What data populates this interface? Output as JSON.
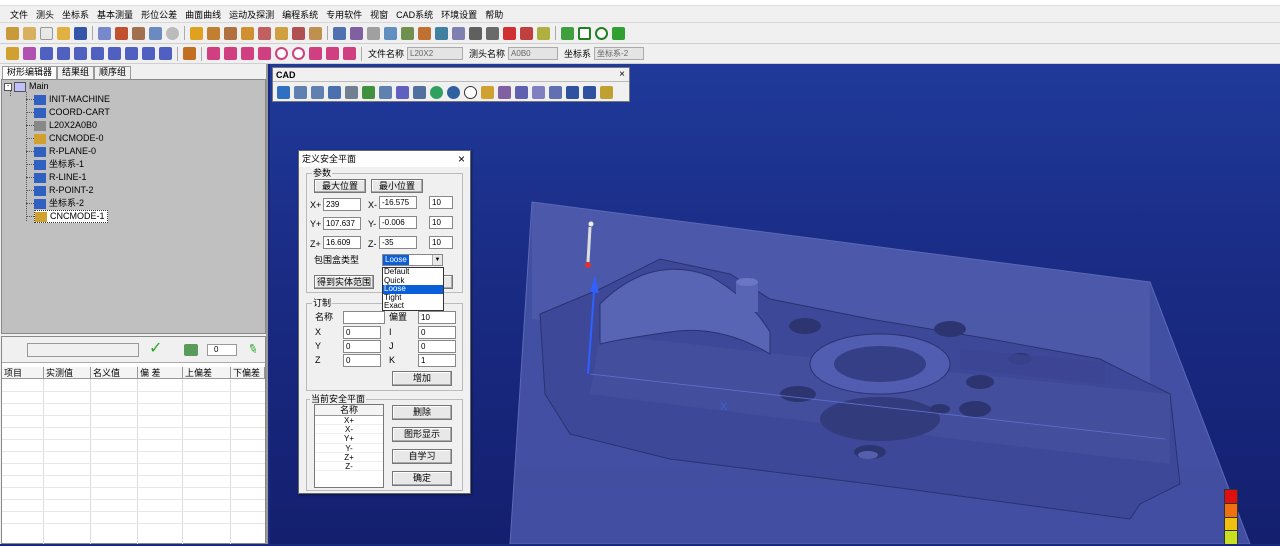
{
  "menu": [
    "文件",
    "测头",
    "坐标系",
    "基本测量",
    "形位公差",
    "曲面曲线",
    "运动及探测",
    "编程系统",
    "专用软件",
    "视窗",
    "CAD系统",
    "环境设置",
    "帮助"
  ],
  "toolbar2": {
    "file_label": "文件名称",
    "file_value": "L20X2",
    "probe_label": "测头名称",
    "probe_value": "A0B0",
    "coord_label": "坐标系",
    "coord_value": "坐标系-2"
  },
  "left_tabs": [
    "树形编辑器",
    "结果组",
    "顺序组"
  ],
  "tree": {
    "root": "Main",
    "items": [
      "INIT-MACHINE",
      "COORD-CART",
      "L20X2A0B0",
      "CNCMODE-0",
      "R-PLANE-0",
      "坐标系-1",
      "R-LINE-1",
      "R-POINT-2",
      "坐标系-2",
      "CNCMODE-1"
    ]
  },
  "bottom_pane": {
    "value_field": "0",
    "columns": [
      "项目",
      "实测值",
      "名义值",
      "偏 差",
      "上偏差",
      "下偏差"
    ]
  },
  "cad": {
    "title": "CAD",
    "close": "×"
  },
  "dialog": {
    "title": "定义安全平面",
    "close": "×",
    "params_group": "参数",
    "max_pos_btn": "最大位置",
    "min_pos_btn": "最小位置",
    "xplus_label": "X+",
    "xplus_value": "239",
    "xminus_label": "X-",
    "xminus_value": "-16.575",
    "x_margin": "10",
    "yplus_label": "Y+",
    "yplus_value": "107.637",
    "yminus_label": "Y-",
    "yminus_value": "-0.006",
    "y_margin": "10",
    "zplus_label": "Z+",
    "zplus_value": "16.609",
    "zminus_label": "Z-",
    "zminus_value": "-35",
    "z_margin": "10",
    "box_type_label": "包围盒类型",
    "box_type_value": "Loose",
    "box_type_options": [
      "Default",
      "Quick",
      "Loose",
      "Tight",
      "Exact"
    ],
    "get_range_btn": "得到实体范围",
    "custom_group": "订制",
    "name_label": "名称",
    "name_value": "",
    "offset_label": "偏置",
    "offset_value": "10",
    "x_label": "X",
    "x_value": "0",
    "y_label": "Y",
    "y_value": "0",
    "z_label": "Z",
    "z_value": "0",
    "i_label": "I",
    "i_value": "0",
    "j_label": "J",
    "j_value": "0",
    "k_label": "K",
    "k_value": "1",
    "add_btn": "增加",
    "current_group": "当前安全平面",
    "list_header": "名称",
    "planes": [
      "X+",
      "X-",
      "Y+",
      "Y-",
      "Z+",
      "Z-"
    ],
    "delete_btn": "删除",
    "show_btn": "图形显示",
    "learn_btn": "自学习",
    "ok_btn": "确定"
  },
  "colors": {
    "viewport_bg": "#1a2c86",
    "part": "#4a55a8",
    "highlight": "#0a5fd8",
    "check": "#2aa52a"
  },
  "scale_colors": [
    "#e01010",
    "#f07010",
    "#f0c010",
    "#c8e020"
  ]
}
